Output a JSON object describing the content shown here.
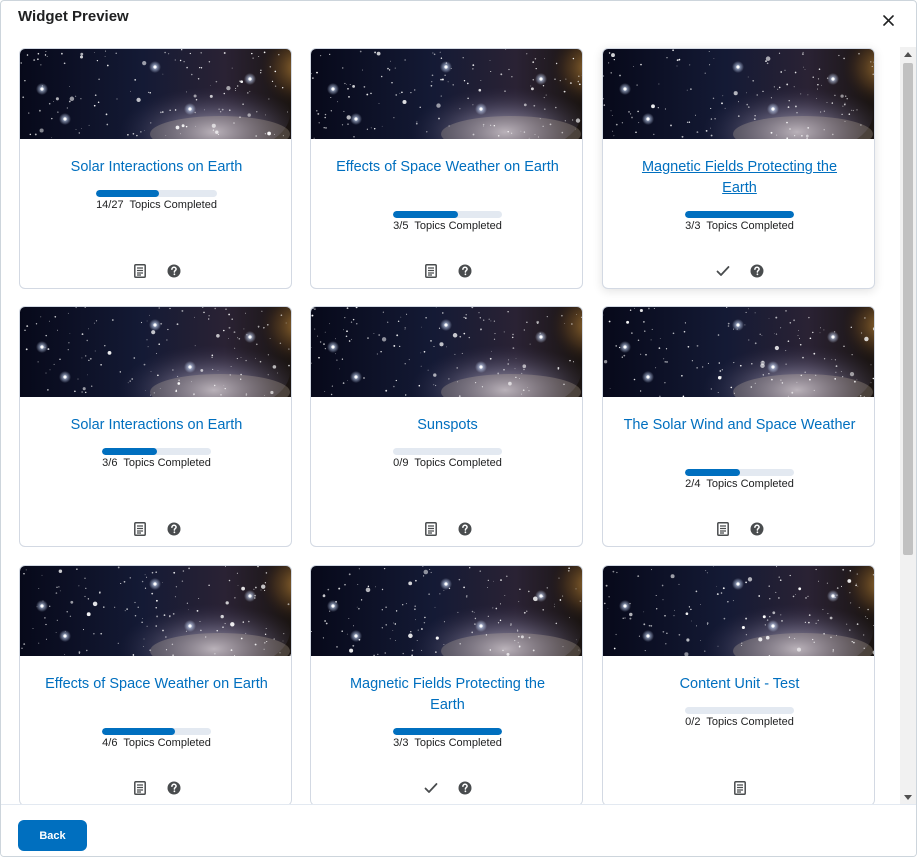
{
  "dialog": {
    "title": "Widget Preview",
    "close_icon": "close-icon",
    "back_label": "Back"
  },
  "colors": {
    "accent": "#006fbf",
    "progress_track": "#e3e9f1",
    "text": "#202122"
  },
  "progress_suffix": "Topics Completed",
  "cards": [
    {
      "title": "Solar Interactions on Earth",
      "completed": 14,
      "total": 27,
      "progress_text": "14/27  Topics Completed",
      "icons": [
        "document-icon",
        "help-icon"
      ]
    },
    {
      "title": "Effects of Space Weather on Earth",
      "completed": 3,
      "total": 5,
      "progress_text": "3/5  Topics Completed",
      "icons": [
        "document-icon",
        "help-icon"
      ]
    },
    {
      "title": "Magnetic Fields Protecting the Earth",
      "completed": 3,
      "total": 3,
      "progress_text": "3/3  Topics Completed",
      "icons": [
        "checkmark-icon",
        "help-icon"
      ],
      "hovered": true
    },
    {
      "title": "Solar Interactions on Earth",
      "completed": 3,
      "total": 6,
      "progress_text": "3/6  Topics Completed",
      "icons": [
        "document-icon",
        "help-icon"
      ]
    },
    {
      "title": "Sunspots",
      "completed": 0,
      "total": 9,
      "progress_text": "0/9  Topics Completed",
      "icons": [
        "document-icon",
        "help-icon"
      ]
    },
    {
      "title": "The Solar Wind and Space Weather",
      "completed": 2,
      "total": 4,
      "progress_text": "2/4  Topics Completed",
      "icons": [
        "document-icon",
        "help-icon"
      ]
    },
    {
      "title": "Effects of Space Weather on Earth",
      "completed": 4,
      "total": 6,
      "progress_text": "4/6  Topics Completed",
      "icons": [
        "document-icon",
        "help-icon"
      ]
    },
    {
      "title": "Magnetic Fields Protecting the Earth",
      "completed": 3,
      "total": 3,
      "progress_text": "3/3  Topics Completed",
      "icons": [
        "checkmark-icon",
        "help-icon"
      ]
    },
    {
      "title": "Content Unit - Test",
      "completed": 0,
      "total": 2,
      "progress_text": "0/2  Topics Completed",
      "icons": [
        "document-icon"
      ]
    }
  ]
}
